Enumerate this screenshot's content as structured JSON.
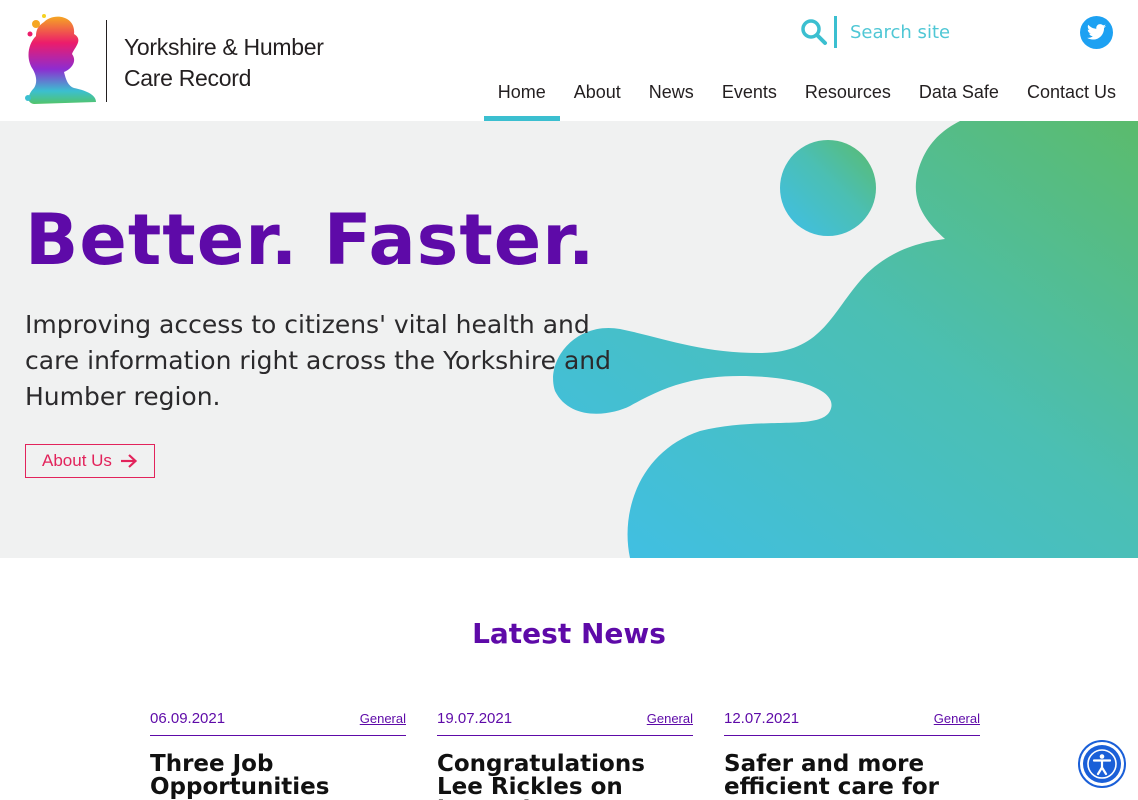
{
  "brand": {
    "line1": "Yorkshire & Humber",
    "line2": "Care Record"
  },
  "search": {
    "placeholder": "Search site"
  },
  "nav": [
    "Home",
    "About",
    "News",
    "Events",
    "Resources",
    "Data Safe",
    "Contact Us"
  ],
  "hero": {
    "title": "Better. Faster.",
    "text": "Improving access to citizens' vital health and care information right across the Yorkshire and Humber region.",
    "button": "About Us"
  },
  "news": {
    "heading": "Latest News",
    "items": [
      {
        "date": "06.09.2021",
        "category": "General",
        "title": "Three Job Opportunities"
      },
      {
        "date": "19.07.2021",
        "category": "General",
        "title": "Congratulations Lee Rickles on becoming"
      },
      {
        "date": "12.07.2021",
        "category": "General",
        "title": "Safer and more efficient care for"
      }
    ]
  },
  "colors": {
    "purple": "#5e0aa8",
    "teal": "#3bbfd0",
    "pink": "#e2235b",
    "twitter": "#1da1f2",
    "accessibility": "#1a5fd8"
  },
  "icons": [
    "search-icon",
    "twitter-icon",
    "arrow-right-icon",
    "accessibility-icon"
  ]
}
